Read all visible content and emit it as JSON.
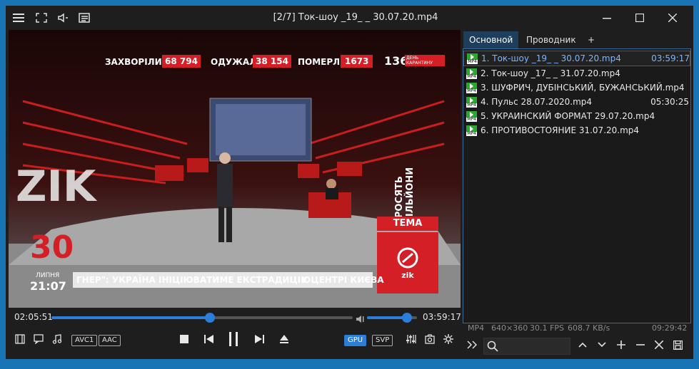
{
  "window": {
    "title": "[2/7] Ток-шоу _19_ _ 30.07.20.mp4",
    "icons": [
      "menu-icon",
      "fullscreen-icon",
      "volume-icon",
      "playlist-icon"
    ]
  },
  "video": {
    "overlay": {
      "counters": [
        {
          "label": "ЗАХВОРІЛИ",
          "value": "68 794"
        },
        {
          "label": "ОДУЖАЛИ",
          "value": "38 154"
        },
        {
          "label": "ПОМЕРЛИ",
          "value": "1673"
        }
      ],
      "days_number": "136",
      "days_text": "ДЕНЬ КАРАНТИНУ",
      "date_day": "30",
      "date_month": "ЛИПНЯ",
      "date_time": "21:07",
      "ticker": "ГНЕР\": УКРАЇНА ІНІЦІЮВАТИМЕ ЕКСТРАДИЦІЮ",
      "ticker2": "У ЦЕНТРІ КИЄВА",
      "topic_label": "ТЕМА",
      "vertical_text": "ПРОСЯТЬ МІЛЬЙОНИ",
      "channel_logo": "zik"
    }
  },
  "seek": {
    "current": "02:05:51",
    "duration": "03:59:17",
    "progress": 0.525,
    "volume": 0.8
  },
  "controls": {
    "codec_video": "AVC1",
    "codec_audio": "AAC",
    "gpu": "GPU",
    "svp": "SVP"
  },
  "panel": {
    "tabs": [
      "Основной",
      "Проводник",
      "+"
    ],
    "items": [
      {
        "name": "1. Ток-шоу _19_ _ 30.07.20.mp4",
        "duration": "03:59:17",
        "selected": true
      },
      {
        "name": "2. Ток-шоу _17_ _ 31.07.20.mp4",
        "duration": "",
        "selected": false
      },
      {
        "name": "3. ШУФРИЧ, ДУБІНСЬКИЙ, БУЖАНСЬКИЙ.mp4",
        "duration": "",
        "selected": false
      },
      {
        "name": "4. Пульс 28.07.2020.mp4",
        "duration": "05:30:25",
        "selected": false
      },
      {
        "name": "5. УКРАИНСКИЙ ФОРМАТ 29.07.20.mp4",
        "duration": "",
        "selected": false
      },
      {
        "name": "6. ПРОТИВОСТОЯНИЕ 31.07.20.mp4",
        "duration": "",
        "selected": false
      }
    ],
    "file_icon_text": "MP4",
    "status": {
      "format": "MP4",
      "resolution": "640×360",
      "fps": "30.1 FPS",
      "rate": "608.7 KB/s",
      "total": "09:29:42"
    }
  }
}
